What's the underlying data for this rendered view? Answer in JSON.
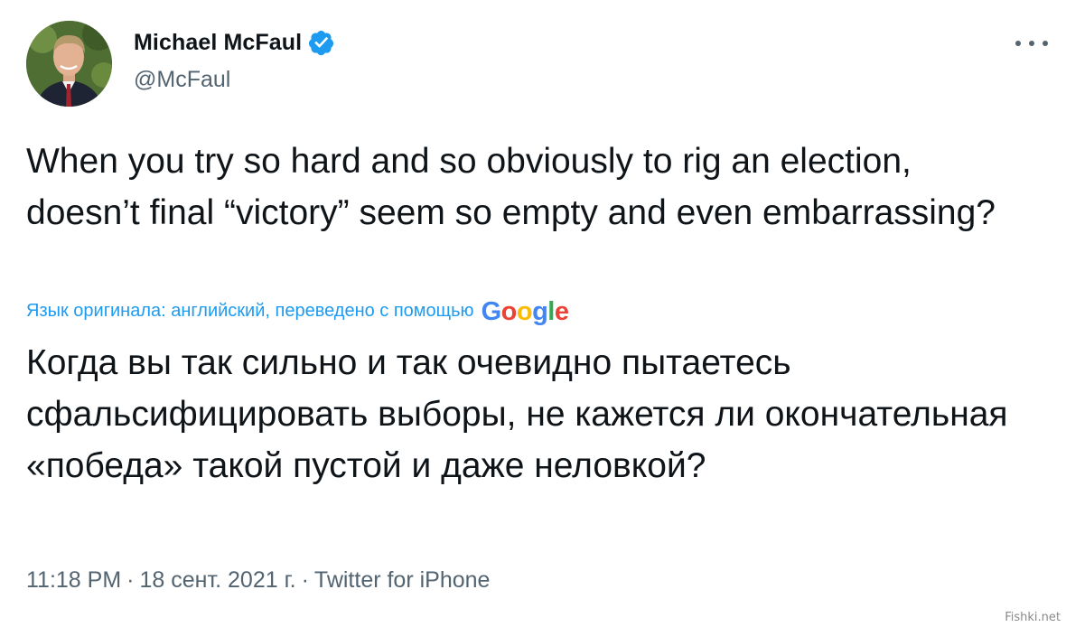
{
  "author": {
    "display_name": "Michael McFaul",
    "handle": "@McFaul",
    "verified": true
  },
  "tweet": {
    "text": "When you try so hard and so obviously to rig an election, doesn’t final “victory” seem so empty and even embarrassing?",
    "translation_note": "Язык оригинала: английский, переведено с помощью",
    "translation_provider": "Google",
    "translated_text": "Когда вы так сильно и так очевидно пытаетесь сфальсифицировать выборы, не кажется ли окончательная «победа» такой пустой и даже неловкой?",
    "time": "11:18 PM",
    "date": "18 сент. 2021 г.",
    "source": "Twitter for iPhone",
    "separator": "·"
  },
  "watermark": "Fishki.net",
  "colors": {
    "link_blue": "#1d9bf0",
    "text_primary": "#0f1419",
    "text_secondary": "#536471",
    "google_blue": "#4285F4",
    "google_red": "#EA4335",
    "google_yellow": "#FBBC05",
    "google_green": "#34A853"
  },
  "icons": [
    "verified-badge-icon",
    "more-options-icon"
  ]
}
